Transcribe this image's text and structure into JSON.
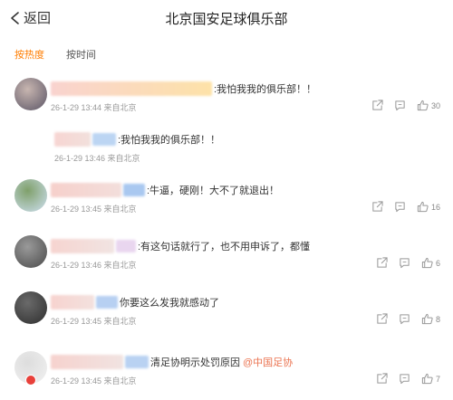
{
  "header": {
    "back_label": "返回",
    "title": "北京国安足球俱乐部"
  },
  "tabs": [
    {
      "label": "按热度",
      "active": true
    },
    {
      "label": "按时间",
      "active": false
    }
  ],
  "colors": {
    "accent": "#ff7d00",
    "mention": "#eb7350",
    "meta": "#999999",
    "icon": "#999999"
  },
  "comments": [
    {
      "text": ":我怕我我的俱乐部！！",
      "meta": "26-1-29 13:44 来自北京",
      "likes": "30",
      "avatar_colors": [
        "#5b5566",
        "#c8b6b0"
      ],
      "strip_colors": [
        "#f9d3cf",
        "#fde2a8"
      ],
      "chip_color": ""
    },
    {
      "text": ":我怕我我的俱乐部！！",
      "meta": "26-1-29 13:46 来自北京",
      "strip_colors": [
        "#f7d5d2",
        "#f2e0dc"
      ],
      "chip_color": "#bcd5f3"
    },
    {
      "text": ":牛逼，硬刚！大不了就退出！",
      "meta": "26-1-29 13:45 来自北京",
      "likes": "16",
      "avatar_colors": [
        "#cfe0f2",
        "#7fa06a"
      ],
      "strip_colors": [
        "#f6d0cb",
        "#f3dedb"
      ],
      "chip_color": "#a9c8f0"
    },
    {
      "text": ":有这句话就行了，也不用申诉了，都懂",
      "meta": "26-1-29 13:46 来自北京",
      "likes": "6",
      "avatar_colors": [
        "#4a4a4a",
        "#9a9a9a"
      ],
      "strip_colors": [
        "#f6d4d0",
        "#f1e4e2"
      ],
      "chip_color": "#e9d6ef"
    },
    {
      "text": "你要这么发我就感动了",
      "meta": "26-1-29 13:45 来自北京",
      "likes": "8",
      "avatar_colors": [
        "#2e2e2e",
        "#6a6a6a"
      ],
      "strip_colors": [
        "#f7d3cf",
        "#f3e1de"
      ],
      "chip_color": "#b7d0f2"
    },
    {
      "text": "清足协明示处罚原因",
      "mention": "@中国足协",
      "meta": "26-1-29 13:45 来自北京",
      "likes": "7",
      "avatar_colors": [
        "#f1f1f1",
        "#dddddd"
      ],
      "has_badge": true,
      "strip_colors": [
        "#f6d2ce",
        "#f1e3e1"
      ],
      "chip_color": "#b9d2f2"
    }
  ]
}
